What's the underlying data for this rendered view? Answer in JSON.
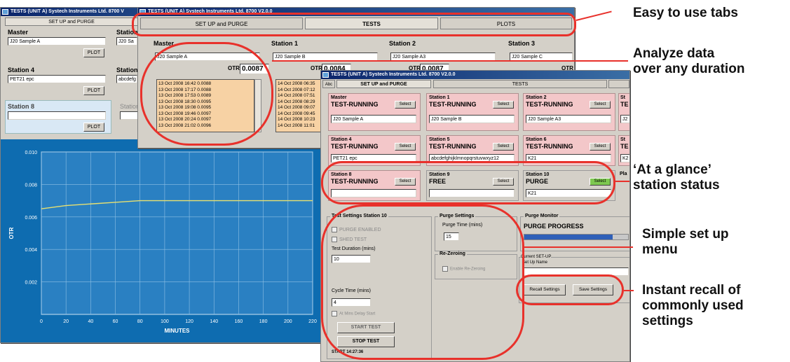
{
  "win1": {
    "title": "TESTS (UNIT A) Systech Instruments Ltd. 8700 V",
    "tab": "SET UP and PURGE",
    "master_label": "Master",
    "master_value": "J20 Sample A",
    "station_label": "Station",
    "station_value": "J20 Sa",
    "station4_label": "Station 4",
    "station4_value": "PET21 epc",
    "station_label2": "Station",
    "station_value2": "abcdefg",
    "station8_label": "Station 8",
    "station_label3": "Station",
    "plot_label": "PLOT"
  },
  "chart_data": {
    "type": "line",
    "title": "",
    "xlabel": "MINUTES",
    "ylabel": "OTR",
    "x_ticks": [
      "0",
      "20",
      "40",
      "60",
      "80",
      "100",
      "120",
      "140",
      "160",
      "180",
      "200",
      "220"
    ],
    "y_ticks": [
      "0.010",
      "0.008",
      "0.006",
      "0.004",
      "0.002"
    ],
    "xlim": [
      0,
      220
    ],
    "ylim": [
      0,
      0.01
    ],
    "series": [
      {
        "x": [
          0,
          20,
          40,
          60,
          80,
          100,
          120,
          140,
          160,
          180,
          200,
          220
        ],
        "y": [
          0.0065,
          0.0067,
          0.0068,
          0.0069,
          0.007,
          0.007,
          0.007,
          0.007,
          0.007,
          0.007,
          0.007,
          0.007
        ],
        "color": "#e8e070"
      }
    ],
    "grid": true
  },
  "win2": {
    "title": "TESTS (UNIT A) Systech Instruments Ltd. 8700 V2.0.0",
    "tabs": [
      "SET UP and PURGE",
      "TESTS",
      "PLOTS"
    ],
    "master_label": "Master",
    "master_value": "J20 Sample A",
    "otr_label": "OTR",
    "otr_value": "0.0087",
    "station1_label": "Station 1",
    "station1_value": "J20 Sample B",
    "station1_otr": "0.0084",
    "station2_label": "Station 2",
    "station2_value": "J20 Sample A3",
    "station2_otr": "0.0087",
    "station3_label": "Station 3",
    "station3_value": "J20 Sample C",
    "log_master": [
      "13 Oct 2008 16:42  0.0088",
      "13 Oct 2008 17:17  0.0088",
      "13 Oct 2008 17:53  0.0089",
      "13 Oct 2008 18:30  0.0095",
      "13 Oct 2008 19:08  0.0095",
      "13 Oct 2008 19:46  0.0097",
      "13 Oct 2008 20:24  0.0097",
      "13 Oct 2008 21:02  0.0096"
    ],
    "log_station1": [
      "14 Oct 2008 06:35",
      "14 Oct 2008 07:12",
      "14 Oct 2008 07:51",
      "14 Oct 2008 08:29",
      "14 Oct 2008 09:07",
      "14 Oct 2008 09:45",
      "14 Oct 2008 10:23",
      "14 Oct 2008 11:01"
    ]
  },
  "win3": {
    "title": "TESTS (UNIT A) Systech Instruments Ltd. 8700 V2.0.0",
    "small_tab": "Abc",
    "tabs": [
      "SET UP and PURGE",
      "TESTS"
    ],
    "select_label": "Select",
    "stations": [
      {
        "name": "Master",
        "status": "TEST-RUNNING",
        "value": "J20 Sample A"
      },
      {
        "name": "Station 1",
        "status": "TEST-RUNNING",
        "value": "J20 Sample B"
      },
      {
        "name": "Station 2",
        "status": "TEST-RUNNING",
        "value": "J20 Sample A3"
      },
      {
        "name": "Station 4",
        "status": "TEST-RUNNING",
        "value": "PET21 epc"
      },
      {
        "name": "Station 5",
        "status": "TEST-RUNNING",
        "value": "abcdefghijklmnopqrstuvwxyz12"
      },
      {
        "name": "Station 6",
        "status": "TEST-RUNNING",
        "value": "K21"
      },
      {
        "name": "Station 8",
        "status": "TEST-RUNNING",
        "value": ""
      },
      {
        "name": "Station 9",
        "status": "FREE",
        "value": ""
      },
      {
        "name": "Station 10",
        "status": "PURGE",
        "value": "K21"
      }
    ],
    "edge_stations": [
      "St",
      "TE",
      "J2",
      "St",
      "TE",
      "K2",
      "Pla"
    ],
    "test_settings_title": "Test Settings Station 10",
    "purge_enabled": "PURGE ENABLED",
    "shed_test": "SHED TEST",
    "test_duration_label": "Test Duration (mins)",
    "test_duration_value": "10",
    "cycle_time_label": "Cycle Time (mins)",
    "cycle_time_value": "4",
    "delay_start": "At Mins Delay Start",
    "start_test": "START TEST",
    "stop_test": "STOP TEST",
    "start_time": "START 14:27:36",
    "purge_settings_title": "Purge Settings",
    "purge_time_label": "Purge Time (mins)",
    "purge_time_value": "15",
    "rezeroing_title": "Re-Zeroing",
    "enable_rezeroing": "Enable Re-Zeroing",
    "purge_monitor_title": "Purge Monitor",
    "purge_progress": "PURGE PROGRESS",
    "purge_progress_fraction": 0.85,
    "current_setup": "Current SET-UP",
    "setup_name_label": "Set Up Name",
    "recall_settings": "Recall Settings",
    "save_settings": "Save Settings"
  },
  "callouts": {
    "tabs": "Easy to use tabs",
    "analyze_1": "Analyze data",
    "analyze_2": "over any duration",
    "glance_1": "‘At a glance’",
    "glance_2": "station status",
    "setup_1": "Simple set up",
    "setup_2": "menu",
    "recall_1": "Instant recall of",
    "recall_2": "commonly used",
    "recall_3": "settings"
  },
  "colors": {
    "highlight": "#e8312b",
    "station_pink": "#f3c7c9",
    "plot_bg": "#0e6cb0",
    "log_bg": "#f7d2a4",
    "progress_blue": "#2f5fb8"
  }
}
